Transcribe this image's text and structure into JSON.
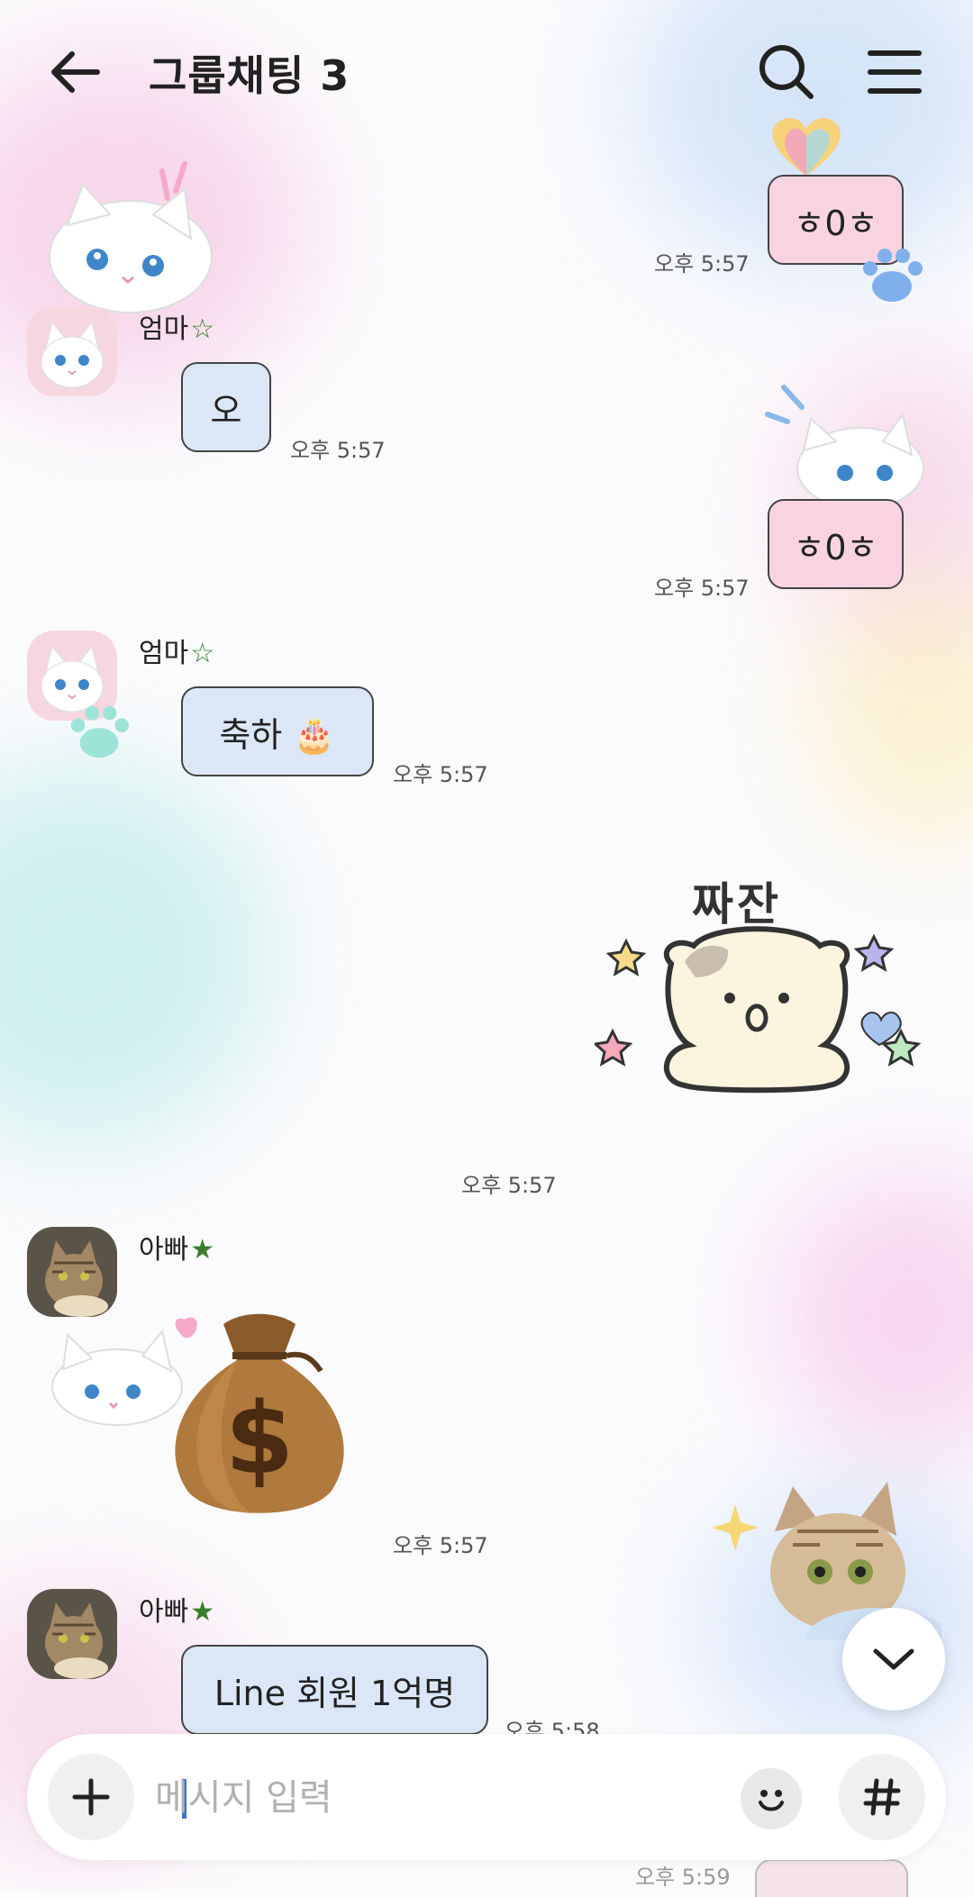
{
  "header": {
    "title": "그룹채팅 3",
    "back_icon": "arrow-left-icon",
    "search_icon": "search-icon",
    "menu_icon": "hamburger-menu-icon"
  },
  "messages": [
    {
      "sender": "me",
      "type": "text",
      "text": "ㅎ0ㅎ",
      "time": "오후 5:57"
    },
    {
      "sender": "엄마",
      "badge": "☆",
      "type": "text",
      "text": "오",
      "time": "오후 5:57"
    },
    {
      "sender": "me",
      "type": "text",
      "text": "ㅎ0ㅎ",
      "time": "오후 5:57"
    },
    {
      "sender": "엄마",
      "badge": "☆",
      "type": "text",
      "text": "축하 🎂",
      "time": "오후 5:57"
    },
    {
      "sender": "me",
      "type": "sticker",
      "sticker_text": "짜잔",
      "time": "오후 5:57"
    },
    {
      "sender": "아빠",
      "badge": "★",
      "type": "emoji",
      "emoji": "💰",
      "time": "오후 5:57"
    },
    {
      "sender": "아빠",
      "badge": "★",
      "type": "text",
      "text": "Line  회원 1억명",
      "time": "오후 5:58"
    }
  ],
  "partial_time": "오후 5:59",
  "scroll_down_icon": "chevron-down-icon",
  "composer": {
    "add_icon": "plus-icon",
    "placeholder": "메시지 입력",
    "emoji_icon": "emoji-icon",
    "hashtag_icon": "hashtag-icon"
  },
  "colors": {
    "my_bubble": "#f8d4e2",
    "their_bubble": "#dbe7f7",
    "badge_green": "#3a7d2c"
  }
}
